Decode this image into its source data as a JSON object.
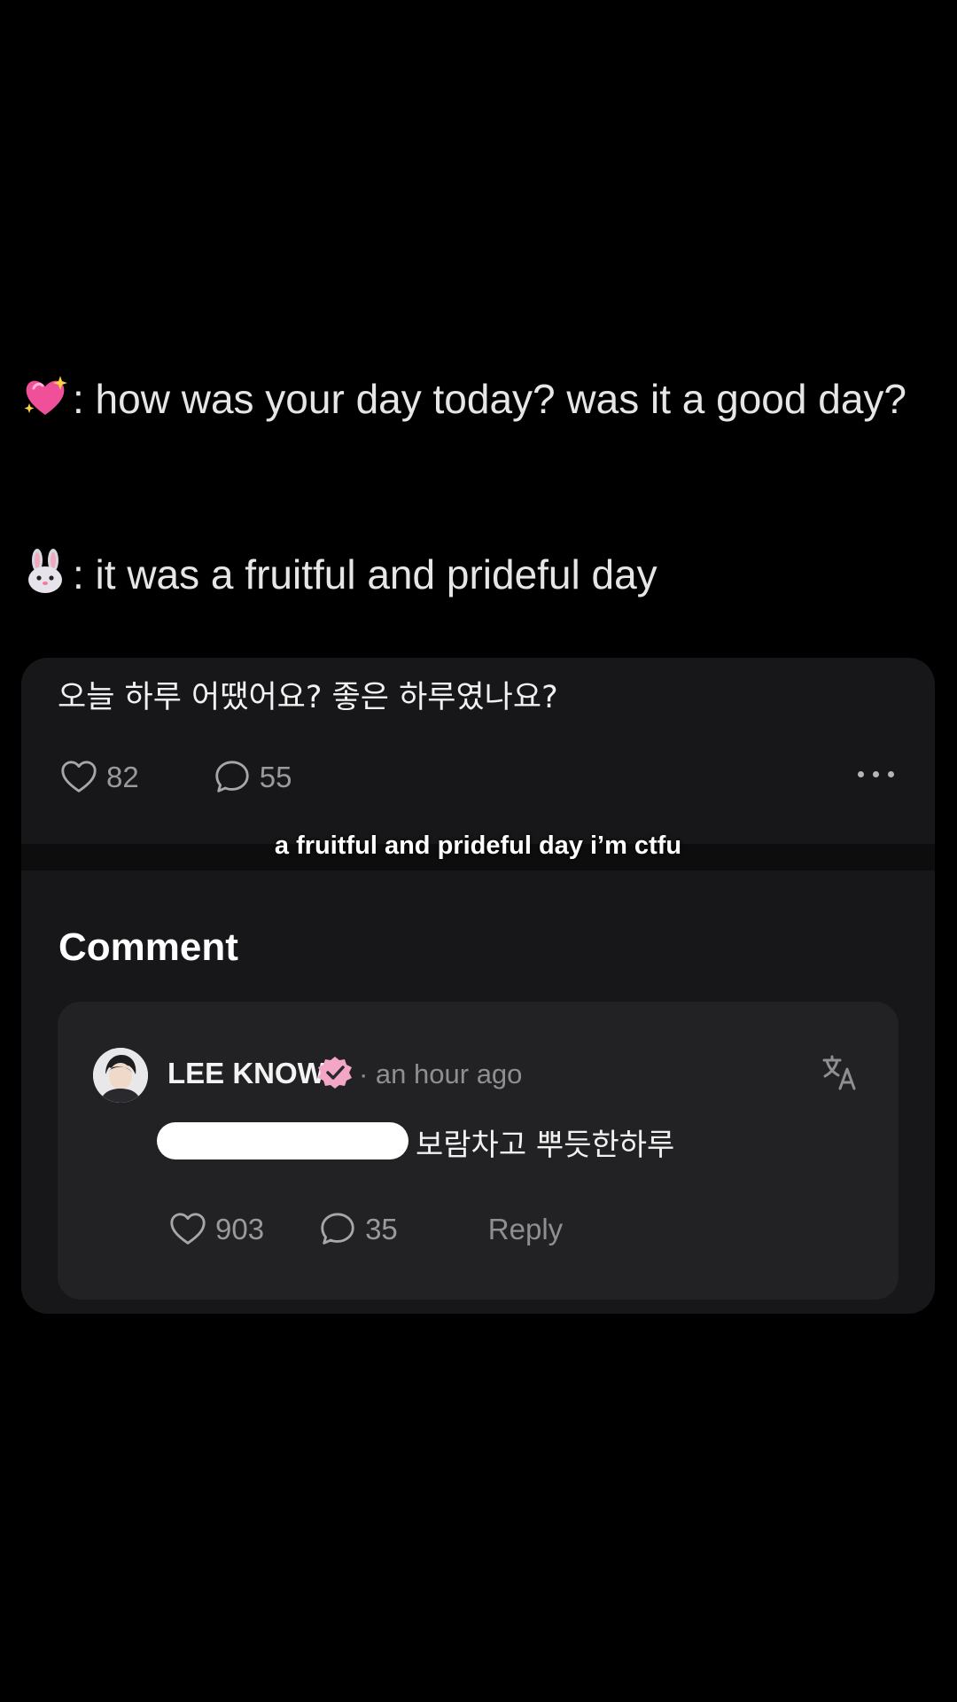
{
  "caption": {
    "line1": {
      "emoji": "sparkling-heart-icon",
      "text": ": how was your day today? was it a good day?"
    },
    "line2": {
      "emoji": "rabbit-face-icon",
      "text": ": it was a fruitful and prideful day"
    }
  },
  "post": {
    "text": "오늘 하루 어땠어요? 좋은 하루였나요?",
    "likes": "82",
    "comments": "55"
  },
  "video_subtitle": "a fruitful and prideful day i’m ctfu",
  "comment_section": {
    "heading": "Comment",
    "comment": {
      "author": "LEE KNOW",
      "timestamp": "· an hour ago",
      "text": "보람차고 뿌듯한하루",
      "likes": "903",
      "replies": "35",
      "reply_label": "Reply"
    }
  },
  "colors": {
    "background": "#000000",
    "card": "#171719",
    "comment_box": "#222225",
    "verified_badge": "#f4a6c6",
    "muted_text": "#8f8f93"
  }
}
